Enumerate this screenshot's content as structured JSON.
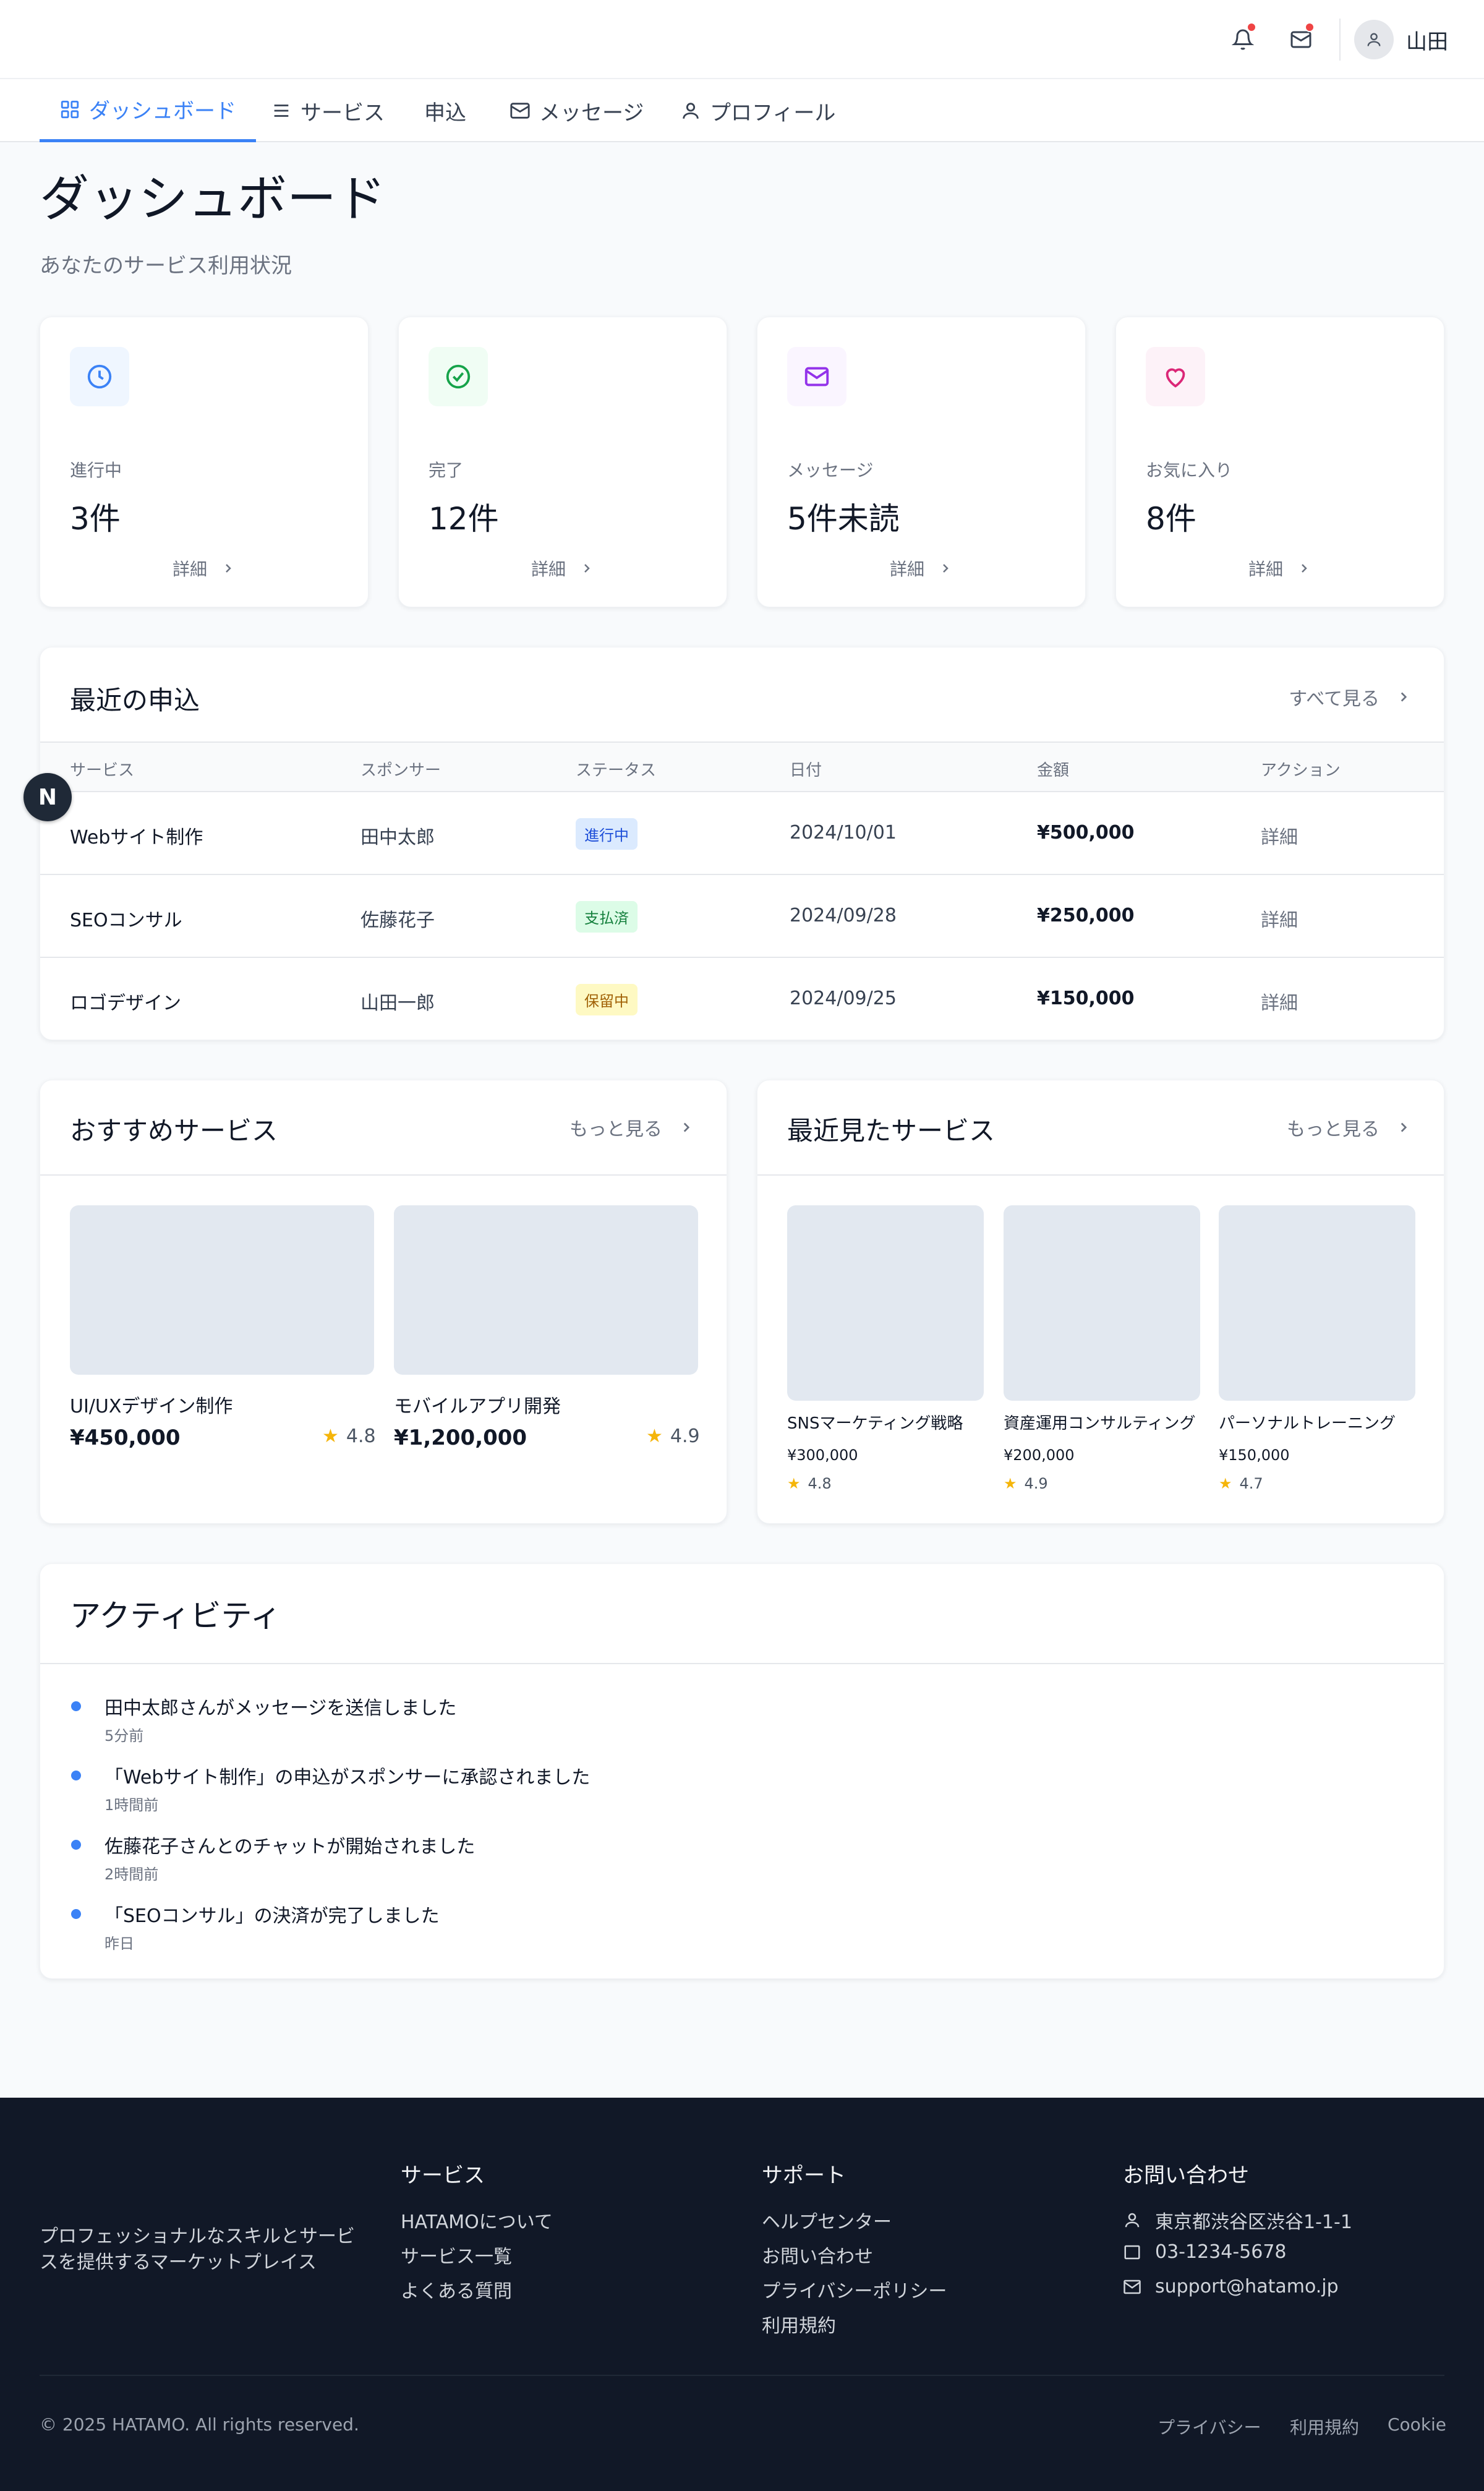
{
  "header": {
    "user_name": "山田"
  },
  "nav": {
    "tabs": [
      {
        "label": "ダッシュボード"
      },
      {
        "label": "サービス"
      },
      {
        "label": "申込"
      },
      {
        "label": "メッセージ"
      },
      {
        "label": "プロフィール"
      }
    ]
  },
  "page": {
    "title": "ダッシュボード",
    "subtitle": "あなたのサービス利用状況"
  },
  "stats": [
    {
      "label": "進行中",
      "value": "3件",
      "link": "詳細",
      "icon": "clock-icon",
      "color": "#3b82f6",
      "bg": "#eff6ff"
    },
    {
      "label": "完了",
      "value": "12件",
      "link": "詳細",
      "icon": "check-circle-icon",
      "color": "#16a34a",
      "bg": "#f0fdf4"
    },
    {
      "label": "メッセージ",
      "value": "5件未読",
      "link": "詳細",
      "icon": "mail-icon",
      "color": "#9333ea",
      "bg": "#faf5ff"
    },
    {
      "label": "お気に入り",
      "value": "8件",
      "link": "詳細",
      "icon": "heart-icon",
      "color": "#db2777",
      "bg": "#fdf2f8"
    }
  ],
  "recent_applications": {
    "title": "最近の申込",
    "view_all": "すべて見る",
    "columns": [
      "サービス",
      "スポンサー",
      "ステータス",
      "日付",
      "金額",
      "アクション"
    ],
    "rows": [
      {
        "service": "Webサイト制作",
        "sponsor": "田中太郎",
        "status": "進行中",
        "date": "2024/10/01",
        "amount": "¥500,000",
        "action": "詳細"
      },
      {
        "service": "SEOコンサル",
        "sponsor": "佐藤花子",
        "status": "支払済",
        "date": "2024/09/28",
        "amount": "¥250,000",
        "action": "詳細"
      },
      {
        "service": "ロゴデザイン",
        "sponsor": "山田一郎",
        "status": "保留中",
        "date": "2024/09/25",
        "amount": "¥150,000",
        "action": "詳細"
      }
    ]
  },
  "recommended": {
    "title": "おすすめサービス",
    "more": "もっと見る",
    "items": [
      {
        "name": "UI/UXデザイン制作",
        "price": "¥450,000",
        "rating": "4.8"
      },
      {
        "name": "モバイルアプリ開発",
        "price": "¥1,200,000",
        "rating": "4.9"
      }
    ]
  },
  "recently_viewed": {
    "title": "最近見たサービス",
    "more": "もっと見る",
    "items": [
      {
        "name": "SNSマーケティング戦略",
        "price": "¥300,000",
        "rating": "4.8"
      },
      {
        "name": "資産運用コンサルティング",
        "price": "¥200,000",
        "rating": "4.9"
      },
      {
        "name": "パーソナルトレーニング",
        "price": "¥150,000",
        "rating": "4.7"
      }
    ]
  },
  "activity": {
    "title": "アクティビティ",
    "items": [
      {
        "text": "田中太郎さんがメッセージを送信しました",
        "time": "5分前"
      },
      {
        "text": "「Webサイト制作」の申込がスポンサーに承認されました",
        "time": "1時間前"
      },
      {
        "text": "佐藤花子さんとのチャットが開始されました",
        "time": "2時間前"
      },
      {
        "text": "「SEOコンサル」の決済が完了しました",
        "time": "昨日"
      }
    ]
  },
  "floating_badge": "N",
  "footer": {
    "tagline": "プロフェッショナルなスキルとサービスを提供するマーケットプレイス",
    "services": {
      "heading": "サービス",
      "links": [
        "HATAMOについて",
        "サービス一覧",
        "よくある質問"
      ]
    },
    "support": {
      "heading": "サポート",
      "links": [
        "ヘルプセンター",
        "お問い合わせ",
        "プライバシーポリシー",
        "利用規約"
      ]
    },
    "contact": {
      "heading": "お問い合わせ",
      "address": "東京都渋谷区渋谷1-1-1",
      "phone": "03-1234-5678",
      "email": "support@hatamo.jp"
    },
    "copyright": "© 2025 HATAMO. All rights reserved.",
    "bottom_links": [
      "プライバシー",
      "利用規約",
      "Cookie"
    ]
  }
}
